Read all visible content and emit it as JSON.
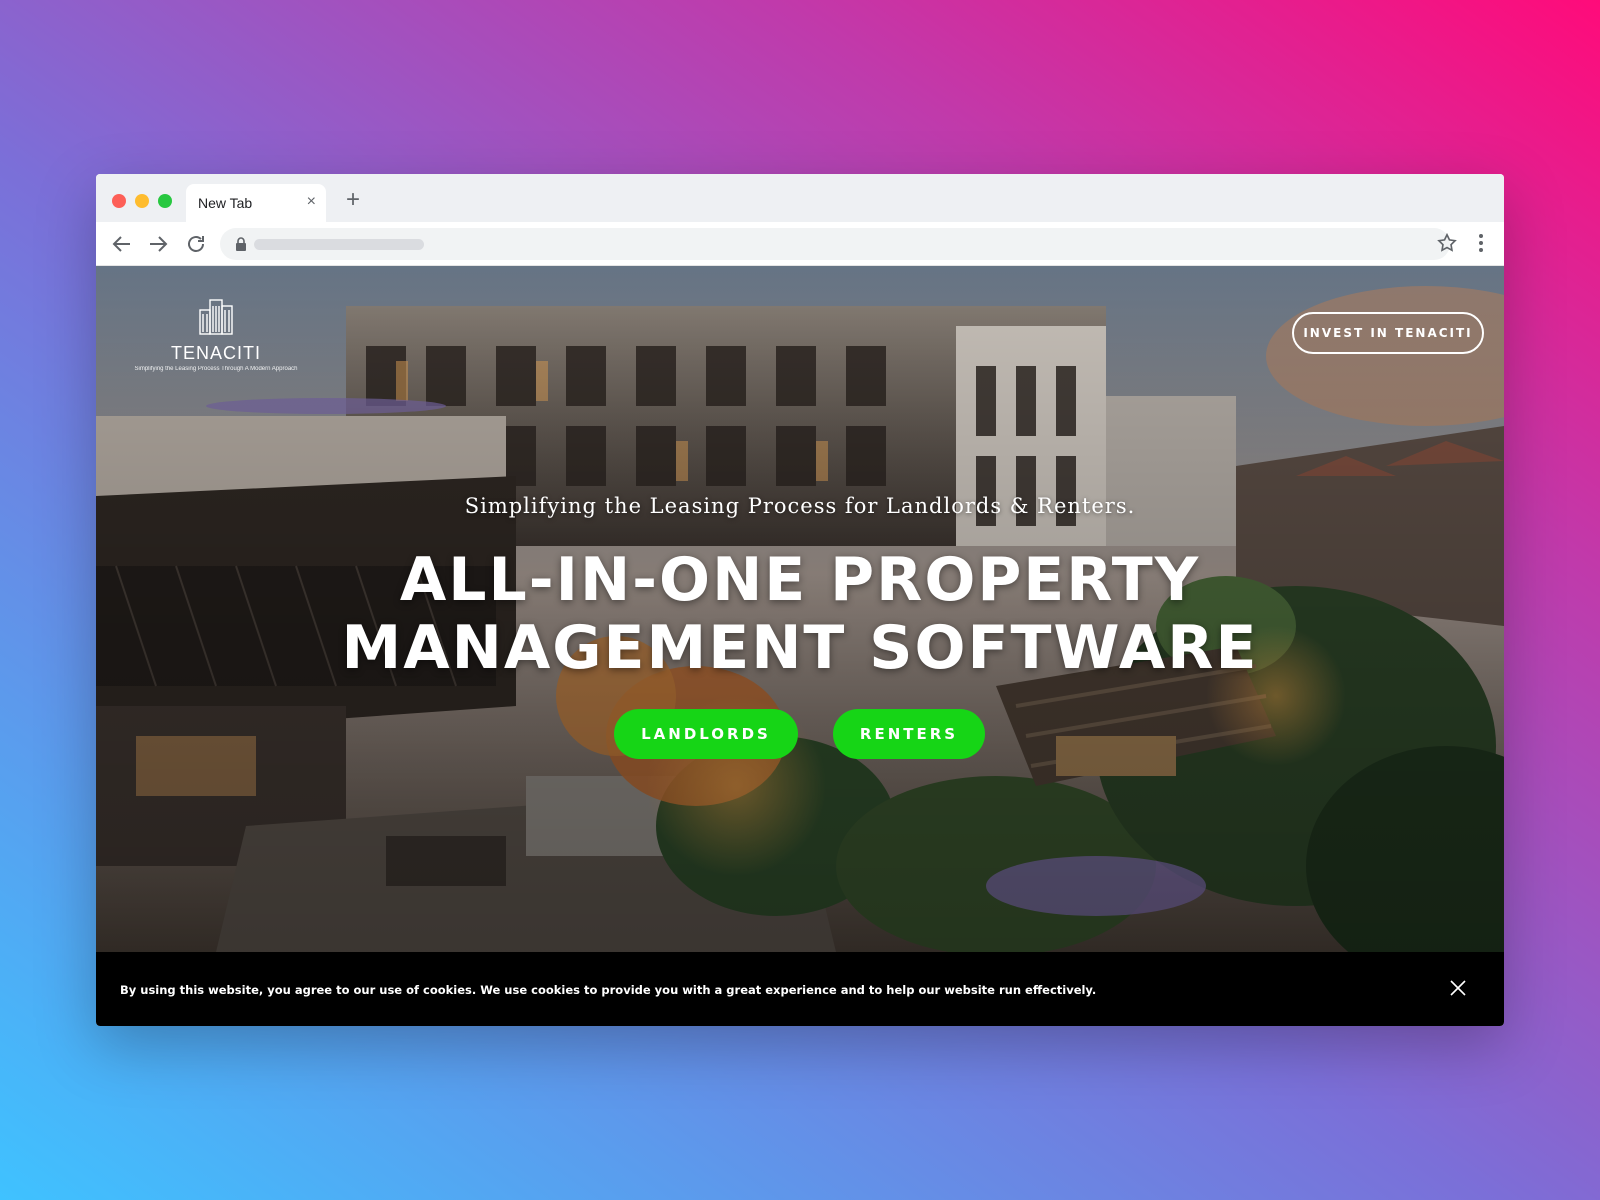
{
  "browser": {
    "tab_title": "New Tab",
    "tab_close_glyph": "×",
    "new_tab_glyph": "+"
  },
  "site": {
    "logo_name": "TENACITI",
    "logo_tagline": "Simplifying the Leasing Process Through A Modern Approach",
    "invest_button": "INVEST IN TENACITI",
    "subtitle": "Simplifying the Leasing Process for Landlords & Renters.",
    "headline_line1": "ALL-IN-ONE PROPERTY",
    "headline_line2": "MANAGEMENT SOFTWARE",
    "cta_landlords": "LANDLORDS",
    "cta_renters": "RENTERS"
  },
  "cookie_banner": {
    "message": "By using this website, you agree to our use of cookies. We use cookies to provide you with a great experience and to help our website run effectively."
  },
  "colors": {
    "cta_green": "#16d516",
    "banner_bg": "#000000"
  },
  "icons": [
    "back-arrow-icon",
    "forward-arrow-icon",
    "reload-icon",
    "lock-icon",
    "star-icon",
    "kebab-menu-icon",
    "close-icon",
    "building-logo-icon"
  ]
}
